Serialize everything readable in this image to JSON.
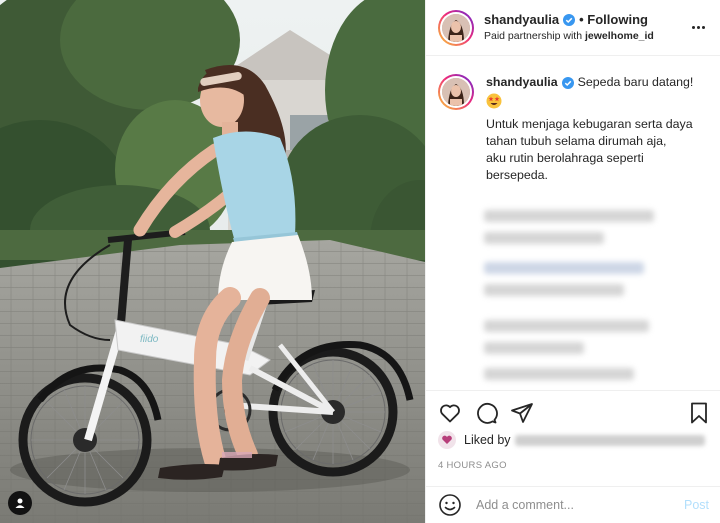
{
  "post": {
    "username": "shandyaulia",
    "following_label": "• Following",
    "partnership_prefix": "Paid partnership with ",
    "partner": "jewelhome_id",
    "more_icon": "more-horizontal-icon"
  },
  "caption": {
    "username": "shandyaulia",
    "title": "Sepeda baru datang!",
    "emoji": "star-struck-emoji",
    "body": "Untuk menjaga kebugaran serta daya\ntahan tubuh selama dirumah aja,\naku rutin berolahraga seperti\nbersepeda."
  },
  "actions": {
    "like_icon": "heart-icon",
    "comment_icon": "comment-icon",
    "share_icon": "paper-plane-icon",
    "save_icon": "bookmark-icon"
  },
  "likes": {
    "prefix": "Liked by"
  },
  "timestamp": "4 HOURS AGO",
  "comment": {
    "placeholder": "Add a comment...",
    "post_label": "Post",
    "emoji_icon": "smile-icon"
  },
  "colors": {
    "accent_blue": "#b2dffc",
    "verified_blue": "#3897f0",
    "muted_text": "#8e8e8e",
    "divider": "#efefef"
  }
}
